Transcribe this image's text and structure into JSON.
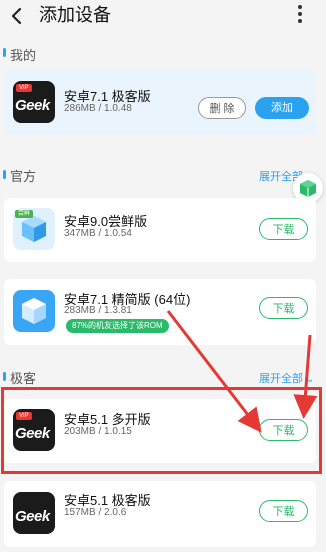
{
  "header": {
    "title": "添加设备",
    "back_icon": "arrow-left-icon",
    "more_icon": "more-vertical-icon"
  },
  "sections": {
    "mine": {
      "label": "我的"
    },
    "official": {
      "label": "官方",
      "expand": "展开全部"
    },
    "geek": {
      "label": "极客",
      "expand": "展开全部"
    }
  },
  "mine_card": {
    "name": "安卓7.1 极客版",
    "meta": "286MB / 1.0.48",
    "delete_label": "删 除",
    "add_label": "添加",
    "icon_text": "Geek",
    "vip": "VIP"
  },
  "official_cards": [
    {
      "name": "安卓9.0尝鲜版",
      "meta": "347MB / 1.0.54",
      "download_label": "下载",
      "badge": "尝鲜"
    },
    {
      "name": "安卓7.1 精简版 (64位)",
      "meta": "283MB / 1.3.81",
      "download_label": "下载",
      "pill": "87%的机友选择了该ROM"
    }
  ],
  "geek_cards": [
    {
      "name": "安卓5.1 多开版",
      "meta": "203MB / 1.0.15",
      "download_label": "下载",
      "icon_text": "Geek",
      "vip": "VIP"
    },
    {
      "name": "安卓5.1 极客版",
      "meta": "157MB / 2.0.6",
      "download_label": "下载",
      "icon_text": "Geek"
    }
  ],
  "colors": {
    "accent": "#2ba2f0",
    "green": "#2aba6a",
    "annotation_red": "#e53935",
    "vip_red": "#e53935"
  }
}
